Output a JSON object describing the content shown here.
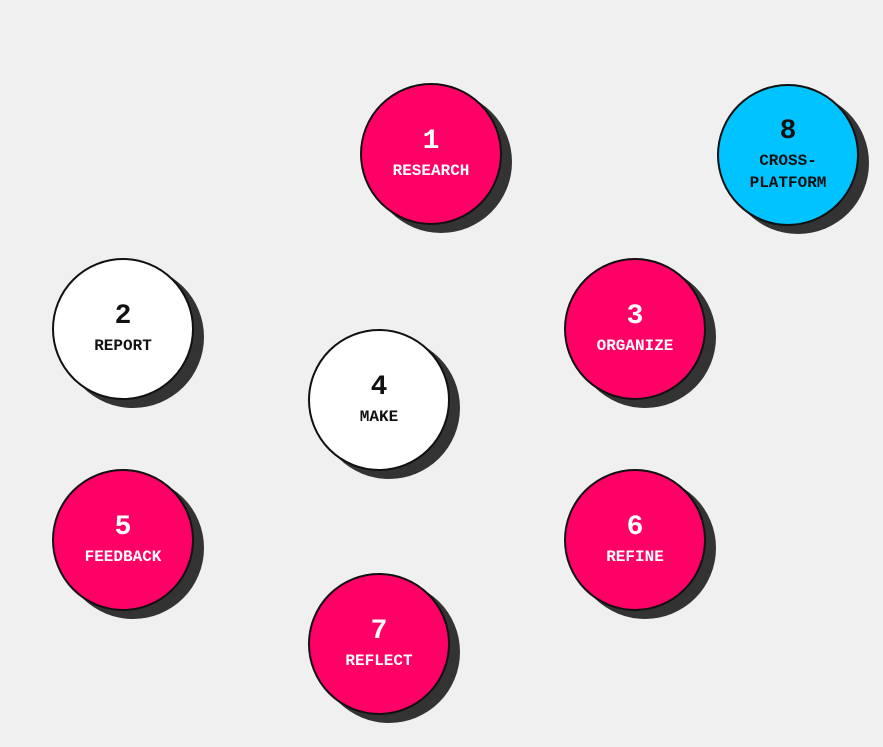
{
  "colors": {
    "background": "#f0f0f0",
    "pink": "#ff0066",
    "white": "#ffffff",
    "cyan": "#00c3ff",
    "shadow": "#333333",
    "border": "#111111"
  },
  "nodes": [
    {
      "number": "1",
      "label": "RESEARCH",
      "color": "pink"
    },
    {
      "number": "2",
      "label": "REPORT",
      "color": "white"
    },
    {
      "number": "3",
      "label": "ORGANIZE",
      "color": "pink"
    },
    {
      "number": "4",
      "label": "MAKE",
      "color": "white"
    },
    {
      "number": "5",
      "label": "FEEDBACK",
      "color": "pink"
    },
    {
      "number": "6",
      "label": "REFINE",
      "color": "pink"
    },
    {
      "number": "7",
      "label": "REFLECT",
      "color": "pink"
    },
    {
      "number": "8",
      "label": "CROSS-\nPLATFORM",
      "color": "cyan"
    }
  ]
}
